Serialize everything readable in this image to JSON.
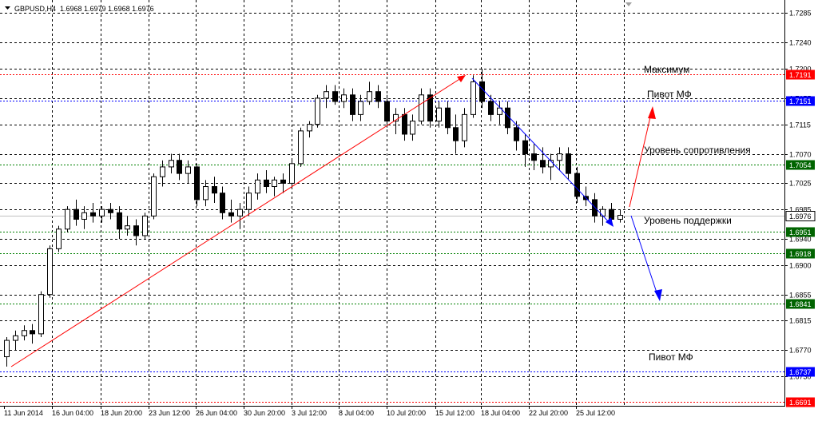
{
  "header": {
    "symbol": "GBPUSD,H4",
    "ohlc": "1.6968 1.6979 1.6968 1.6976"
  },
  "colors": {
    "up_candle": "#ffffff",
    "down_candle": "#000000",
    "red_line": "#ff0000",
    "green_line": "#008000",
    "blue_line": "#0000ff",
    "arrow_red": "#ff0000",
    "arrow_blue": "#0000ff",
    "bid_line": "#c0c0c0"
  },
  "chart_data": {
    "type": "candlestick",
    "x_tick_labels": [
      "11 Jun 2014",
      "16 Jun 04:00",
      "18 Jun 20:00",
      "23 Jun 12:00",
      "26 Jun 04:00",
      "30 Jun 20:00",
      "3 Jul 12:00",
      "8 Jul 04:00",
      "10 Jul 20:00",
      "15 Jul 12:00",
      "18 Jul 04:00",
      "22 Jul 20:00",
      "25 Jul 12:00"
    ],
    "y_tick_labels": [
      "1.7285",
      "1.7240",
      "1.7200",
      "1.7155",
      "1.7115",
      "1.7070",
      "1.7025",
      "1.6985",
      "1.6940",
      "1.6900",
      "1.6855",
      "1.6815",
      "1.6770",
      "1.6730"
    ],
    "ylim": [
      1.6685,
      1.7305
    ],
    "levels": [
      {
        "value": 1.7191,
        "label": "1.7191",
        "color": "red",
        "annotation": "Максимум"
      },
      {
        "value": 1.7151,
        "label": "1.7151",
        "color": "blue",
        "annotation": "Пивот МФ"
      },
      {
        "value": 1.7054,
        "label": "1.7054",
        "color": "green",
        "annotation": "Уровень сопротивления"
      },
      {
        "value": 1.6951,
        "label": "1.6951",
        "color": "green",
        "annotation": "Уровень поддержки"
      },
      {
        "value": 1.6918,
        "label": "1.6918",
        "color": "green",
        "annotation": ""
      },
      {
        "value": 1.6841,
        "label": "1.6841",
        "color": "green",
        "annotation": ""
      },
      {
        "value": 1.6737,
        "label": "1.6737",
        "color": "blue",
        "annotation": "Пивот МФ"
      },
      {
        "value": 1.6691,
        "label": "1.6691",
        "color": "red",
        "annotation": ""
      }
    ],
    "current_price": {
      "value": 1.6976,
      "label": "1.6976"
    },
    "candles": [
      [
        1.676,
        1.679,
        1.6745,
        1.6785
      ],
      [
        1.6785,
        1.68,
        1.677,
        1.6792
      ],
      [
        1.6792,
        1.6808,
        1.6785,
        1.68
      ],
      [
        1.68,
        1.681,
        1.678,
        1.6795
      ],
      [
        1.6795,
        1.686,
        1.679,
        1.6855
      ],
      [
        1.6855,
        1.693,
        1.685,
        1.6925
      ],
      [
        1.6925,
        1.696,
        1.692,
        1.6955
      ],
      [
        1.6955,
        1.699,
        1.695,
        1.6985
      ],
      [
        1.6985,
        1.7,
        1.696,
        1.697
      ],
      [
        1.697,
        1.699,
        1.6955,
        1.698
      ],
      [
        1.698,
        1.6995,
        1.6965,
        1.6975
      ],
      [
        1.6975,
        1.699,
        1.6965,
        1.6985
      ],
      [
        1.6985,
        1.6995,
        1.697,
        1.698
      ],
      [
        1.698,
        1.699,
        1.694,
        1.6955
      ],
      [
        1.6955,
        1.6975,
        1.6945,
        1.696
      ],
      [
        1.696,
        1.697,
        1.693,
        1.6945
      ],
      [
        1.6945,
        1.698,
        1.694,
        1.6975
      ],
      [
        1.6975,
        1.704,
        1.697,
        1.7035
      ],
      [
        1.7035,
        1.706,
        1.702,
        1.705
      ],
      [
        1.705,
        1.707,
        1.704,
        1.706
      ],
      [
        1.706,
        1.707,
        1.703,
        1.704
      ],
      [
        1.704,
        1.706,
        1.7025,
        1.705
      ],
      [
        1.705,
        1.7055,
        1.699,
        1.7
      ],
      [
        1.7,
        1.703,
        1.699,
        1.702
      ],
      [
        1.702,
        1.7035,
        1.6995,
        1.701
      ],
      [
        1.701,
        1.702,
        1.697,
        1.698
      ],
      [
        1.698,
        1.7,
        1.6965,
        1.6975
      ],
      [
        1.6975,
        1.6995,
        1.6955,
        1.6985
      ],
      [
        1.6985,
        1.702,
        1.6975,
        1.701
      ],
      [
        1.701,
        1.704,
        1.7,
        1.703
      ],
      [
        1.703,
        1.7045,
        1.701,
        1.702
      ],
      [
        1.702,
        1.7035,
        1.7005,
        1.703
      ],
      [
        1.703,
        1.704,
        1.701,
        1.7025
      ],
      [
        1.7025,
        1.706,
        1.702,
        1.7055
      ],
      [
        1.7055,
        1.711,
        1.705,
        1.7105
      ],
      [
        1.7105,
        1.712,
        1.7095,
        1.7115
      ],
      [
        1.7115,
        1.716,
        1.711,
        1.7155
      ],
      [
        1.7155,
        1.7175,
        1.714,
        1.7165
      ],
      [
        1.7165,
        1.7175,
        1.7145,
        1.715
      ],
      [
        1.715,
        1.717,
        1.714,
        1.716
      ],
      [
        1.716,
        1.717,
        1.712,
        1.713
      ],
      [
        1.713,
        1.716,
        1.712,
        1.715
      ],
      [
        1.715,
        1.718,
        1.7145,
        1.7165
      ],
      [
        1.7165,
        1.7175,
        1.714,
        1.715
      ],
      [
        1.715,
        1.716,
        1.711,
        1.712
      ],
      [
        1.712,
        1.714,
        1.71,
        1.713
      ],
      [
        1.713,
        1.714,
        1.709,
        1.71
      ],
      [
        1.71,
        1.713,
        1.709,
        1.712
      ],
      [
        1.712,
        1.717,
        1.7115,
        1.716
      ],
      [
        1.716,
        1.717,
        1.711,
        1.712
      ],
      [
        1.712,
        1.715,
        1.711,
        1.714
      ],
      [
        1.714,
        1.715,
        1.71,
        1.711
      ],
      [
        1.711,
        1.713,
        1.707,
        1.709
      ],
      [
        1.709,
        1.714,
        1.708,
        1.713
      ],
      [
        1.713,
        1.719,
        1.7125,
        1.718
      ],
      [
        1.718,
        1.72,
        1.714,
        1.715
      ],
      [
        1.715,
        1.716,
        1.712,
        1.713
      ],
      [
        1.713,
        1.715,
        1.7115,
        1.714
      ],
      [
        1.714,
        1.715,
        1.71,
        1.711
      ],
      [
        1.711,
        1.712,
        1.7075,
        1.709
      ],
      [
        1.709,
        1.71,
        1.705,
        1.707
      ],
      [
        1.707,
        1.7085,
        1.7045,
        1.706
      ],
      [
        1.706,
        1.708,
        1.704,
        1.705
      ],
      [
        1.705,
        1.707,
        1.703,
        1.706
      ],
      [
        1.706,
        1.708,
        1.7045,
        1.707
      ],
      [
        1.707,
        1.708,
        1.703,
        1.704
      ],
      [
        1.704,
        1.705,
        1.6995,
        1.7005
      ],
      [
        1.7005,
        1.702,
        1.699,
        1.7
      ],
      [
        1.7,
        1.701,
        1.6965,
        1.6975
      ],
      [
        1.6975,
        1.699,
        1.696,
        1.6985
      ],
      [
        1.6985,
        1.6995,
        1.6965,
        1.697
      ],
      [
        1.697,
        1.6985,
        1.6965,
        1.6976
      ]
    ]
  },
  "annotations": {
    "maximum": "Максимум",
    "pivot_top": "Пивот МФ",
    "resistance": "Уровень сопротивления",
    "support": "Уровень поддержки",
    "pivot_bottom": "Пивот МФ"
  }
}
